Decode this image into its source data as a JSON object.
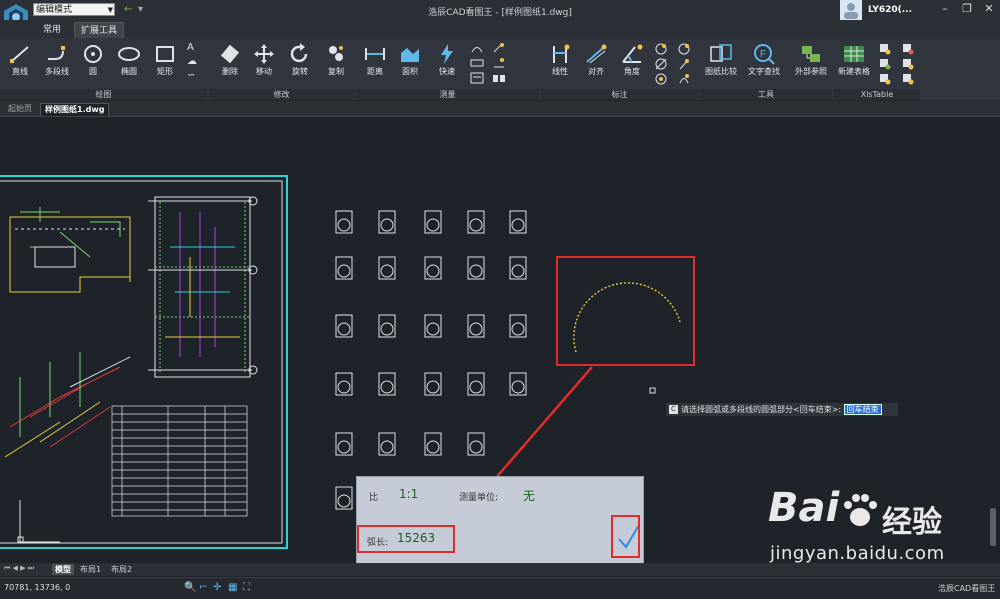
{
  "titlebar": {
    "mode_select": "编辑模式",
    "title": "浩辰CAD看图王 - [样例图纸1.dwg]",
    "user": "LY620(..."
  },
  "ribbon_tabs": [
    "常用",
    "扩展工具"
  ],
  "ribbon": {
    "buttons": [
      {
        "label": "直线",
        "icon": "line-icon"
      },
      {
        "label": "多段线",
        "icon": "polyline-icon"
      },
      {
        "label": "圆",
        "icon": "circle-icon"
      },
      {
        "label": "椭圆",
        "icon": "ellipse-icon"
      },
      {
        "label": "矩形",
        "icon": "rectangle-icon"
      },
      {
        "label": "删除",
        "icon": "eraser-icon"
      },
      {
        "label": "移动",
        "icon": "move-icon"
      },
      {
        "label": "旋转",
        "icon": "rotate-icon"
      },
      {
        "label": "复制",
        "icon": "copy-icon"
      },
      {
        "label": "距离",
        "icon": "distance-icon"
      },
      {
        "label": "面积",
        "icon": "area-icon"
      },
      {
        "label": "快速",
        "icon": "quick-measure-icon"
      },
      {
        "label": "线性",
        "icon": "linear-dim-icon"
      },
      {
        "label": "对齐",
        "icon": "aligned-dim-icon"
      },
      {
        "label": "角度",
        "icon": "angle-dim-icon"
      },
      {
        "label": "图纸比较",
        "icon": "compare-icon"
      },
      {
        "label": "文字查找",
        "icon": "text-find-icon"
      },
      {
        "label": "外部参照",
        "icon": "xref-icon"
      },
      {
        "label": "新建表格",
        "icon": "table-icon"
      }
    ],
    "groups": [
      "绘图",
      "修改",
      "测量",
      "标注",
      "工具",
      "XlsTable"
    ]
  },
  "doc_tabs": [
    "起始页",
    "样例图纸1.dwg"
  ],
  "layout_tabs": [
    "模型",
    "布局1",
    "布局2"
  ],
  "prompt": {
    "text": "请选择圆弧或多段线的圆弧部分<回车结束>:",
    "input": "回车结束"
  },
  "measure_panel": {
    "scale_label": "比",
    "scale_value": "1:1",
    "unit_label": "测量单位:",
    "unit_value": "无",
    "arc_label": "弧长:",
    "arc_value": "15263"
  },
  "status": {
    "coords": "70781, 13736, 0",
    "app": "浩辰CAD看图王"
  },
  "watermark": {
    "logo": "Bai",
    "text": "经验",
    "url": "jingyan.baidu.com"
  },
  "colors": {
    "accent_red": "#e12c2c",
    "canvas_bg": "#1e2229",
    "arc": "#e6d23a",
    "panel_bg": "#c5ccd7"
  }
}
